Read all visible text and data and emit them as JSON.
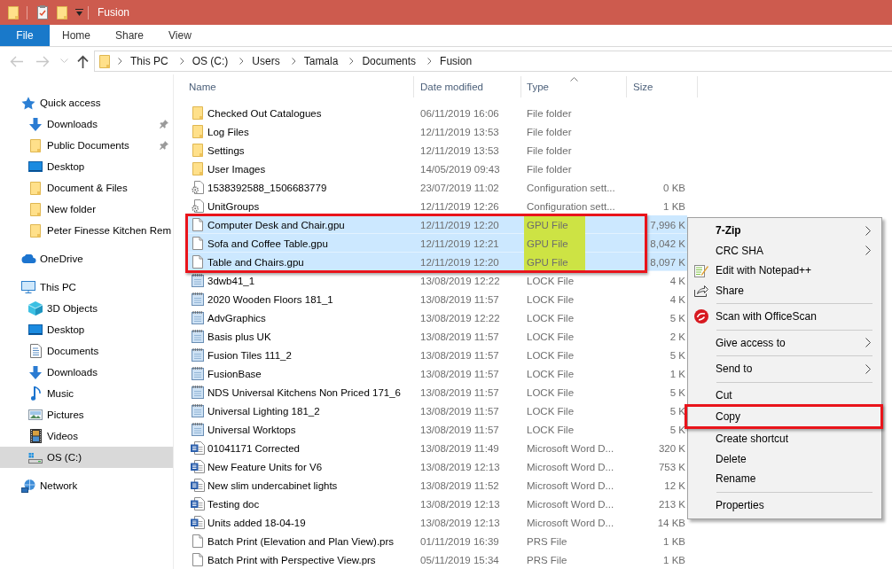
{
  "window": {
    "title": "Fusion"
  },
  "ribbon": {
    "tabs": [
      {
        "label": "File",
        "kind": "backstage"
      },
      {
        "label": "Home",
        "kind": "tab"
      },
      {
        "label": "Share",
        "kind": "tab"
      },
      {
        "label": "View",
        "kind": "tab"
      }
    ]
  },
  "navigation": {
    "buttons": [
      {
        "kind": "back",
        "disabled": true
      },
      {
        "kind": "forward",
        "disabled": true
      },
      {
        "kind": "recent",
        "disabled": true
      },
      {
        "kind": "up",
        "disabled": false
      }
    ],
    "breadcrumbs": [
      "This PC",
      "OS (C:)",
      "Users",
      "Tamala",
      "Documents",
      "Fusion"
    ]
  },
  "sidebar": {
    "items": [
      {
        "label": "Quick access",
        "kind": "quickaccess",
        "selected": false,
        "children": [
          {
            "label": "Downloads",
            "kind": "downloads",
            "pinned": true,
            "selected": false
          },
          {
            "label": "Public Documents",
            "kind": "folder",
            "pinned": true,
            "selected": false
          },
          {
            "label": "Desktop",
            "kind": "desktop",
            "pinned": false,
            "selected": false
          },
          {
            "label": "Document & Files",
            "kind": "folder",
            "pinned": false,
            "selected": false
          },
          {
            "label": "New folder",
            "kind": "folder",
            "pinned": false,
            "selected": false
          },
          {
            "label": "Peter Finesse Kitchen Rem",
            "kind": "folder",
            "pinned": false,
            "selected": false
          }
        ]
      },
      {
        "label": "OneDrive",
        "kind": "onedrive",
        "selected": false
      },
      {
        "label": "This PC",
        "kind": "computer",
        "selected": false,
        "children": [
          {
            "label": "3D Objects",
            "kind": "objects",
            "selected": false
          },
          {
            "label": "Desktop",
            "kind": "desktop",
            "selected": false
          },
          {
            "label": "Documents",
            "kind": "documents",
            "selected": false
          },
          {
            "label": "Downloads",
            "kind": "downloads",
            "selected": false
          },
          {
            "label": "Music",
            "kind": "music",
            "selected": false
          },
          {
            "label": "Pictures",
            "kind": "pictures",
            "selected": false
          },
          {
            "label": "Videos",
            "kind": "videos",
            "selected": false
          },
          {
            "label": "OS (C:)",
            "kind": "drive",
            "selected": true
          }
        ]
      },
      {
        "label": "Network",
        "kind": "network",
        "selected": false
      }
    ]
  },
  "file_list": {
    "columns": [
      {
        "label": "Name",
        "sorted": false
      },
      {
        "label": "Date modified",
        "sorted": false
      },
      {
        "label": "Type",
        "sorted": true
      },
      {
        "label": "Size",
        "sorted": false
      }
    ],
    "rows": [
      {
        "kind": "folder",
        "name": "Checked Out Catalogues",
        "date": "06/11/2019 16:06",
        "type": "File folder",
        "selected": false,
        "outlined": false,
        "marked": false
      },
      {
        "kind": "folder",
        "name": "Log Files",
        "date": "12/11/2019 13:53",
        "type": "File folder",
        "selected": false,
        "outlined": false,
        "marked": false
      },
      {
        "kind": "folder",
        "name": "Settings",
        "date": "12/11/2019 13:53",
        "type": "File folder",
        "selected": false,
        "outlined": false,
        "marked": false
      },
      {
        "kind": "folder",
        "name": "User Images",
        "date": "14/05/2019 09:43",
        "type": "File folder",
        "selected": false,
        "outlined": false,
        "marked": false
      },
      {
        "kind": "config",
        "name": "1538392588_1506683779",
        "date": "23/07/2019 11:02",
        "type": "Configuration sett...",
        "size": "0 KB",
        "selected": false,
        "outlined": false,
        "marked": false
      },
      {
        "kind": "config",
        "name": "UnitGroups",
        "date": "12/11/2019 12:26",
        "type": "Configuration sett...",
        "size": "1 KB",
        "selected": false,
        "outlined": false,
        "marked": false
      },
      {
        "kind": "file",
        "name": "Computer Desk and Chair.gpu",
        "date": "12/11/2019 12:20",
        "type": "GPU File",
        "size": "7,996 K",
        "selected": true,
        "outlined": true,
        "marked": true
      },
      {
        "kind": "file",
        "name": "Sofa and Coffee Table.gpu",
        "date": "12/11/2019 12:21",
        "type": "GPU File",
        "size": "8,042 K",
        "selected": true,
        "outlined": true,
        "marked": true
      },
      {
        "kind": "file",
        "name": "Table and Chairs.gpu",
        "date": "12/11/2019 12:20",
        "type": "GPU File",
        "size": "8,097 K",
        "selected": true,
        "outlined": true,
        "marked": true
      },
      {
        "kind": "lock",
        "name": "3dwb41_1",
        "date": "13/08/2019 12:22",
        "type": "LOCK File",
        "size": "4 K",
        "selected": false,
        "outlined": false,
        "marked": false
      },
      {
        "kind": "lock",
        "name": "2020 Wooden Floors 181_1",
        "date": "13/08/2019 11:57",
        "type": "LOCK File",
        "size": "4 K",
        "selected": false,
        "outlined": false,
        "marked": false
      },
      {
        "kind": "lock",
        "name": "AdvGraphics",
        "date": "13/08/2019 12:22",
        "type": "LOCK File",
        "size": "5 K",
        "selected": false,
        "outlined": false,
        "marked": false
      },
      {
        "kind": "lock",
        "name": "Basis plus UK",
        "date": "13/08/2019 11:57",
        "type": "LOCK File",
        "size": "2 K",
        "selected": false,
        "outlined": false,
        "marked": false
      },
      {
        "kind": "lock",
        "name": "Fusion Tiles 111_2",
        "date": "13/08/2019 11:57",
        "type": "LOCK File",
        "size": "5 K",
        "selected": false,
        "outlined": false,
        "marked": false
      },
      {
        "kind": "lock",
        "name": "FusionBase",
        "date": "13/08/2019 11:57",
        "type": "LOCK File",
        "size": "1 K",
        "selected": false,
        "outlined": false,
        "marked": false
      },
      {
        "kind": "lock",
        "name": "NDS Universal Kitchens Non Priced 171_6",
        "date": "13/08/2019 11:57",
        "type": "LOCK File",
        "size": "5 K",
        "selected": false,
        "outlined": false,
        "marked": false
      },
      {
        "kind": "lock",
        "name": "Universal Lighting 181_2",
        "date": "13/08/2019 11:57",
        "type": "LOCK File",
        "size": "5 K",
        "selected": false,
        "outlined": false,
        "marked": false
      },
      {
        "kind": "lock",
        "name": "Universal Worktops",
        "date": "13/08/2019 11:57",
        "type": "LOCK File",
        "size": "5 K",
        "selected": false,
        "outlined": false,
        "marked": false
      },
      {
        "kind": "word",
        "name": "01041171 Corrected",
        "date": "13/08/2019 11:49",
        "type": "Microsoft Word D...",
        "size": "320 K",
        "selected": false,
        "outlined": false,
        "marked": false
      },
      {
        "kind": "word",
        "name": "New Feature Units for V6",
        "date": "13/08/2019 12:13",
        "type": "Microsoft Word D...",
        "size": "753 K",
        "selected": false,
        "outlined": false,
        "marked": false
      },
      {
        "kind": "word",
        "name": "New slim undercabinet lights",
        "date": "13/08/2019 11:52",
        "type": "Microsoft Word D...",
        "size": "12 K",
        "selected": false,
        "outlined": false,
        "marked": false
      },
      {
        "kind": "word",
        "name": "Testing doc",
        "date": "13/08/2019 12:13",
        "type": "Microsoft Word D...",
        "size": "213 K",
        "selected": false,
        "outlined": false,
        "marked": false
      },
      {
        "kind": "word",
        "name": "Units added 18-04-19",
        "date": "13/08/2019 12:13",
        "type": "Microsoft Word D...",
        "size": "14 KB",
        "selected": false,
        "outlined": false,
        "marked": false
      },
      {
        "kind": "file",
        "name": "Batch Print (Elevation and Plan View).prs",
        "date": "01/11/2019 16:39",
        "type": "PRS File",
        "size": "1 KB",
        "selected": false,
        "outlined": false,
        "marked": false
      },
      {
        "kind": "file",
        "name": "Batch Print with Perspective View.prs",
        "date": "05/11/2019 15:34",
        "type": "PRS File",
        "size": "1 KB",
        "selected": false,
        "outlined": false,
        "marked": false
      }
    ]
  },
  "context_menu": {
    "items": [
      {
        "kind": "submenu",
        "label": "7-Zip",
        "bold": true,
        "outlined": false
      },
      {
        "kind": "submenu",
        "label": "CRC SHA",
        "bold": false,
        "outlined": false
      },
      {
        "kind": "editor",
        "label": "Edit with Notepad++",
        "bold": false,
        "outlined": false
      },
      {
        "kind": "share",
        "label": "Share",
        "bold": false,
        "outlined": false
      },
      {
        "kind": "separator"
      },
      {
        "kind": "antivirus",
        "label": "Scan with OfficeScan",
        "bold": false,
        "outlined": false
      },
      {
        "kind": "separator"
      },
      {
        "kind": "submenu",
        "label": "Give access to",
        "bold": false,
        "outlined": false
      },
      {
        "kind": "separator"
      },
      {
        "kind": "submenu",
        "label": "Send to",
        "bold": false,
        "outlined": false
      },
      {
        "kind": "separator"
      },
      {
        "kind": "command",
        "label": "Cut",
        "bold": false,
        "outlined": false
      },
      {
        "kind": "command",
        "label": "Copy",
        "bold": false,
        "outlined": true
      },
      {
        "kind": "command",
        "label": "Create shortcut",
        "bold": false,
        "outlined": false
      },
      {
        "kind": "command",
        "label": "Delete",
        "bold": false,
        "outlined": false
      },
      {
        "kind": "command",
        "label": "Rename",
        "bold": false,
        "outlined": false
      },
      {
        "kind": "separator"
      },
      {
        "kind": "command",
        "label": "Properties",
        "bold": false,
        "outlined": false
      }
    ]
  }
}
